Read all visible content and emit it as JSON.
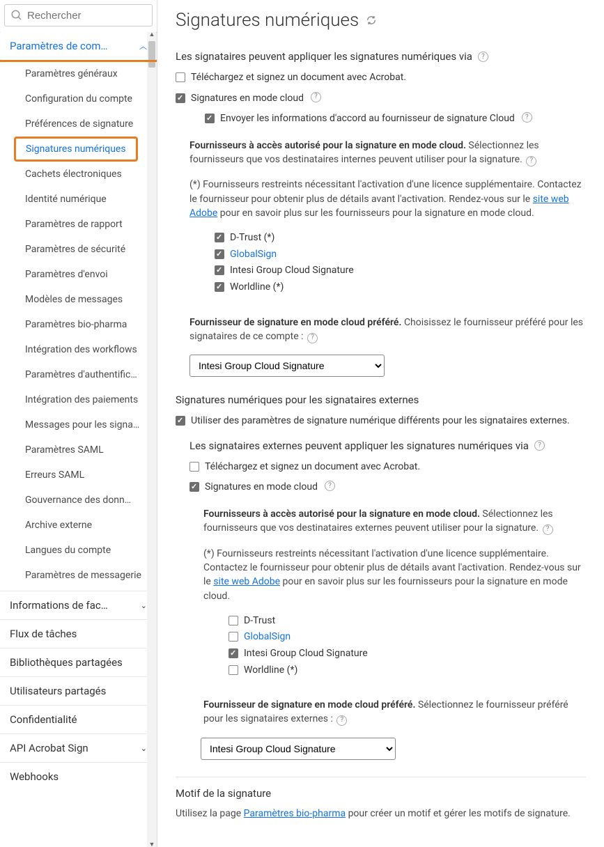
{
  "search": {
    "placeholder": "Rechercher"
  },
  "sidebar": {
    "group_label": "Paramètres de com…",
    "items": [
      {
        "label": "Paramètres généraux"
      },
      {
        "label": "Configuration du compte"
      },
      {
        "label": "Préférences de signature"
      },
      {
        "label": "Signatures numériques",
        "active": true
      },
      {
        "label": "Cachets électroniques"
      },
      {
        "label": "Identité numérique"
      },
      {
        "label": "Paramètres de rapport"
      },
      {
        "label": "Paramètres de sécurité"
      },
      {
        "label": "Paramètres d'envoi"
      },
      {
        "label": "Modèles de messages"
      },
      {
        "label": "Paramètres bio-pharma"
      },
      {
        "label": "Intégration des workflows"
      },
      {
        "label": "Paramètres d'authentific…"
      },
      {
        "label": "Intégration des paiements"
      },
      {
        "label": "Messages pour les signa…"
      },
      {
        "label": "Paramètres SAML"
      },
      {
        "label": "Erreurs SAML"
      },
      {
        "label": "Gouvernance des donn…"
      },
      {
        "label": "Archive externe"
      },
      {
        "label": "Langues du compte"
      },
      {
        "label": "Paramètres de messagerie"
      }
    ],
    "other_groups": [
      {
        "label": "Informations de fac…",
        "chev": "⌄"
      },
      {
        "label": "Flux de tâches"
      },
      {
        "label": "Bibliothèques partagées"
      },
      {
        "label": "Utilisateurs partagés"
      },
      {
        "label": "Confidentialité"
      },
      {
        "label": "API Acrobat Sign",
        "chev": "⌄"
      },
      {
        "label": "Webhooks"
      }
    ]
  },
  "page": {
    "title": "Signatures numériques"
  },
  "sec1": {
    "q": "Les signataires peuvent appliquer les signatures numériques via",
    "opt_dl": "Téléchargez et signez un document avec Acrobat.",
    "opt_cloud": "Signatures en mode cloud",
    "opt_send": "Envoyer les informations d'accord au fournisseur de signature Cloud",
    "prov_title": "Fournisseurs à accès autorisé pour la signature en mode cloud.",
    "prov_desc": "Sélectionnez les fournisseurs que vos destinataires internes peuvent utiliser pour la signature.",
    "restrict_pre": "(*) Fournisseurs restreints nécessitant l'activation d'une licence supplémentaire. Contactez le fournisseur pour obtenir plus de détails avant l'activation. Rendez-vous sur le ",
    "restrict_link": "site web Adobe",
    "restrict_post": " pour en savoir plus sur les fournisseurs pour la signature en mode cloud.",
    "providers": [
      {
        "label": "D-Trust (*)",
        "checked": true
      },
      {
        "label": "GlobalSign",
        "checked": true,
        "link": true
      },
      {
        "label": "Intesi Group Cloud Signature",
        "checked": true
      },
      {
        "label": "Worldline (*)",
        "checked": true
      }
    ],
    "pref_title": "Fournisseur de signature en mode cloud préféré.",
    "pref_desc": "Choisissez le fournisseur préféré pour les signataires de ce compte :",
    "pref_value": "Intesi Group Cloud Signature"
  },
  "sec2": {
    "title": "Signatures numériques pour les signataires externes",
    "use_diff": "Utiliser des paramètres de signature numérique différents pour les signataires externes.",
    "q": "Les signataires externes peuvent appliquer les signatures numériques via",
    "opt_dl": "Téléchargez et signez un document avec Acrobat.",
    "opt_cloud": "Signatures en mode cloud",
    "prov_title": "Fournisseurs à accès autorisé pour la signature en mode cloud.",
    "prov_desc": "Sélectionnez les fournisseurs que vos destinataires externes peuvent utiliser pour la signature.",
    "restrict_pre": "(*) Fournisseurs restreints nécessitant l'activation d'une licence supplémentaire. Contactez le fournisseur pour obtenir plus de détails avant l'activation. Rendez-vous sur le ",
    "restrict_link": "site web Adobe",
    "restrict_post": " pour en savoir plus sur les fournisseurs pour la signature en mode cloud.",
    "providers": [
      {
        "label": "D-Trust",
        "checked": false
      },
      {
        "label": "GlobalSign",
        "checked": false,
        "link": true
      },
      {
        "label": "Intesi Group Cloud Signature",
        "checked": true
      },
      {
        "label": "Worldline (*)",
        "checked": false
      }
    ],
    "pref_title": "Fournisseur de signature en mode cloud préféré.",
    "pref_desc": "Sélectionnez le fournisseur préféré pour les signataires externes :",
    "pref_value": "Intesi Group Cloud Signature"
  },
  "sec3": {
    "title": "Motif de la signature",
    "text_pre": "Utilisez la page ",
    "text_link": "Paramètres bio-pharma",
    "text_post": " pour créer un motif et gérer les motifs de signature."
  }
}
